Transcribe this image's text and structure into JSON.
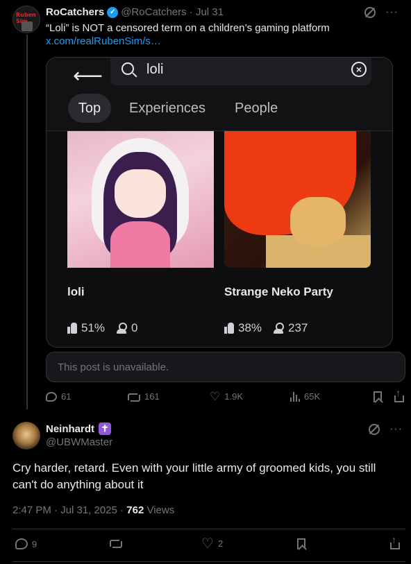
{
  "tweet1": {
    "author_name": "RoCatchers",
    "handle_time": "@RoCatchers · Jul 31",
    "avatar_text": "Ruben Sim",
    "text": "“Loli” is NOT a censored term on a children’s gaming platform",
    "link": "x.com/realRubenSim/s…",
    "media": {
      "search_value": "loli",
      "tabs": [
        "Top",
        "Experiences",
        "People"
      ],
      "games": [
        {
          "title": "loli",
          "rating": "51%",
          "players": "0"
        },
        {
          "title": "Strange Neko Party",
          "rating": "38%",
          "players": "237"
        }
      ]
    },
    "quote_unavailable": "This post is unavailable.",
    "actions": {
      "replies": "61",
      "reposts": "161",
      "likes": "1.9K",
      "views": "65K"
    }
  },
  "tweet2": {
    "author_name": "Neinhardt",
    "handle": "@UBWMaster",
    "badge": "✝",
    "text": "Cry harder, retard. Even with your little army of groomed kids, you still can't do anything about it",
    "timestamp": "2:47 PM · Jul 31, 2025 · ",
    "views_count": "762",
    "views_label": " Views",
    "actions": {
      "replies": "9",
      "likes": "2"
    }
  },
  "colors": {
    "accent": "#1d9bf0",
    "muted": "#71767b",
    "text": "#e7e9ea",
    "background": "#000000"
  }
}
